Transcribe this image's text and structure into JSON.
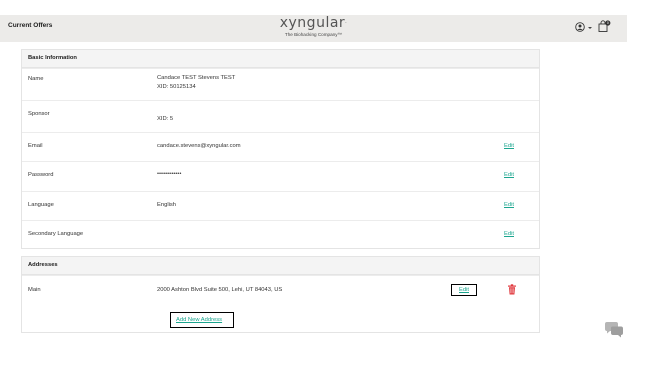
{
  "header": {
    "current_offers": "Current Offers",
    "brand_name": "xyngular",
    "brand_mark": "·",
    "brand_tagline": "The Biohacking Company™",
    "cart_count": "0"
  },
  "basic": {
    "title": "Basic Information",
    "rows": [
      {
        "label": "Name",
        "value": "Candace TEST Stevens TEST",
        "value2": "XID: 50125134",
        "edit": ""
      },
      {
        "label": "Sponsor",
        "value": "",
        "value2": "XID: 5",
        "edit": ""
      },
      {
        "label": "Email",
        "value": "candace.stevens@xyngular.com",
        "value2": "",
        "edit": "Edit"
      },
      {
        "label": "Password",
        "value": "••••••••••••",
        "value2": "",
        "edit": "Edit"
      },
      {
        "label": "Language",
        "value": "English",
        "value2": "",
        "edit": "Edit"
      },
      {
        "label": "Secondary Language",
        "value": "",
        "value2": "",
        "edit": "Edit"
      }
    ]
  },
  "addresses": {
    "title": "Addresses",
    "main_label": "Main",
    "main_value": "2000 Ashton Blvd Suite 500, Lehi, UT 84043, US",
    "edit": "Edit",
    "add_new": "Add New Address"
  },
  "colors": {
    "accent": "#1ba68f",
    "delete": "#e0393e",
    "header_bg": "#ecebe9"
  }
}
